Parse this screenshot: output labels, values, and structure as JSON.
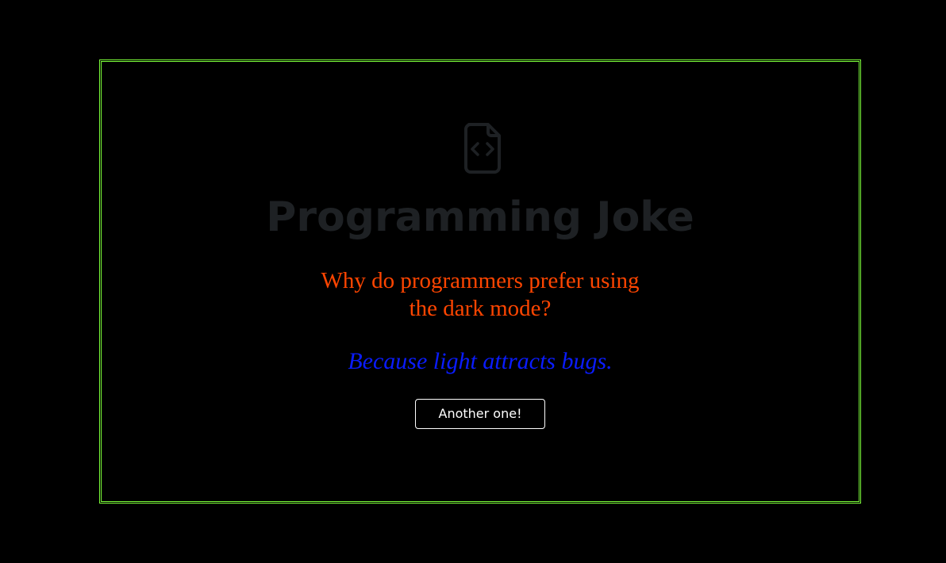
{
  "card": {
    "icon": "file-code-icon",
    "title": "Programming Joke",
    "setup": "Why do programmers prefer using the dark mode?",
    "punchline": "Because light attracts bugs.",
    "button_label": "Another one!"
  },
  "colors": {
    "background": "#000000",
    "frame_border": "#7cfc3a",
    "title": "#1e2124",
    "setup": "#ff4500",
    "punchline": "#0a1cff",
    "button_border": "#ffffff"
  }
}
